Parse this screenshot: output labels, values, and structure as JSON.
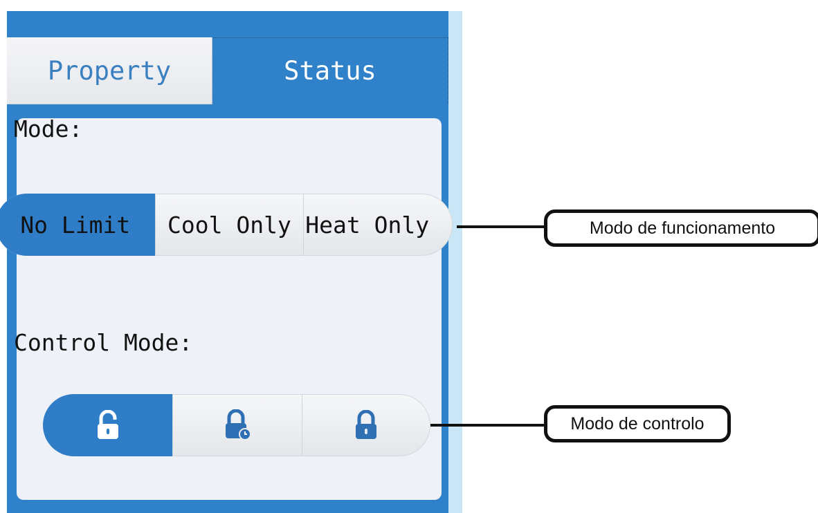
{
  "tabs": {
    "property_label": "Property",
    "status_label": "Status",
    "active": "Status"
  },
  "mode": {
    "label": "Mode:",
    "options": [
      "No Limit",
      "Cool Only",
      "Heat Only"
    ],
    "selected": "No Limit"
  },
  "control_mode": {
    "label": "Control Mode:",
    "options_icons": [
      "unlock-icon",
      "lock-timer-icon",
      "lock-icon"
    ],
    "selected": "unlock-icon"
  },
  "callouts": {
    "mode_text": "Modo de funcionamento",
    "control_text": "Modo de controlo"
  },
  "colors": {
    "accent_blue": "#2f82c9",
    "active_segment": "#2f7cc7",
    "panel_bg": "#eef1f8"
  }
}
